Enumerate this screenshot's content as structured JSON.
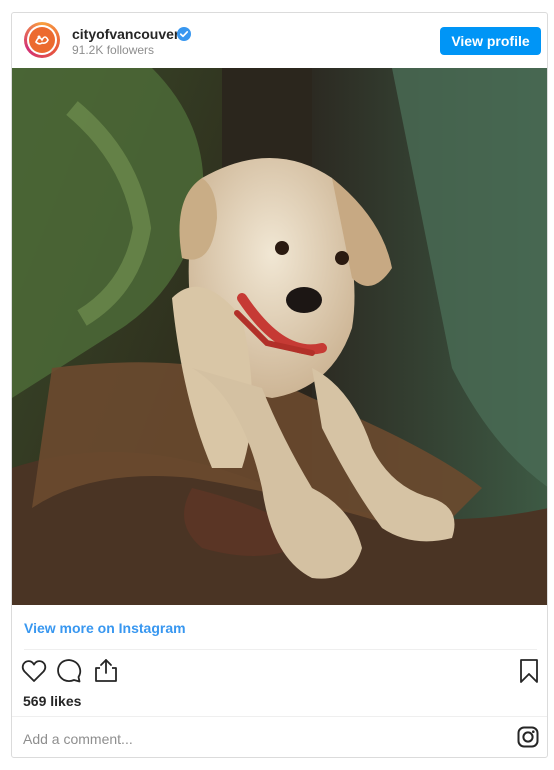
{
  "header": {
    "username": "cityofvancouver",
    "followers": "91.2K followers",
    "view_profile_label": "View profile"
  },
  "post": {
    "view_more_label": "View more on Instagram",
    "likes": "569 likes",
    "comment_placeholder": "Add a comment..."
  },
  "icons": {
    "avatar": "city-of-vancouver-logo",
    "verified": "verified-badge-icon",
    "like": "heart-icon",
    "comment": "comment-icon",
    "share": "share-icon",
    "save": "bookmark-icon",
    "instagram": "instagram-icon"
  },
  "colors": {
    "accent": "#0095f6",
    "link": "#3897f0",
    "brand_orange": "#ec6a2f"
  }
}
